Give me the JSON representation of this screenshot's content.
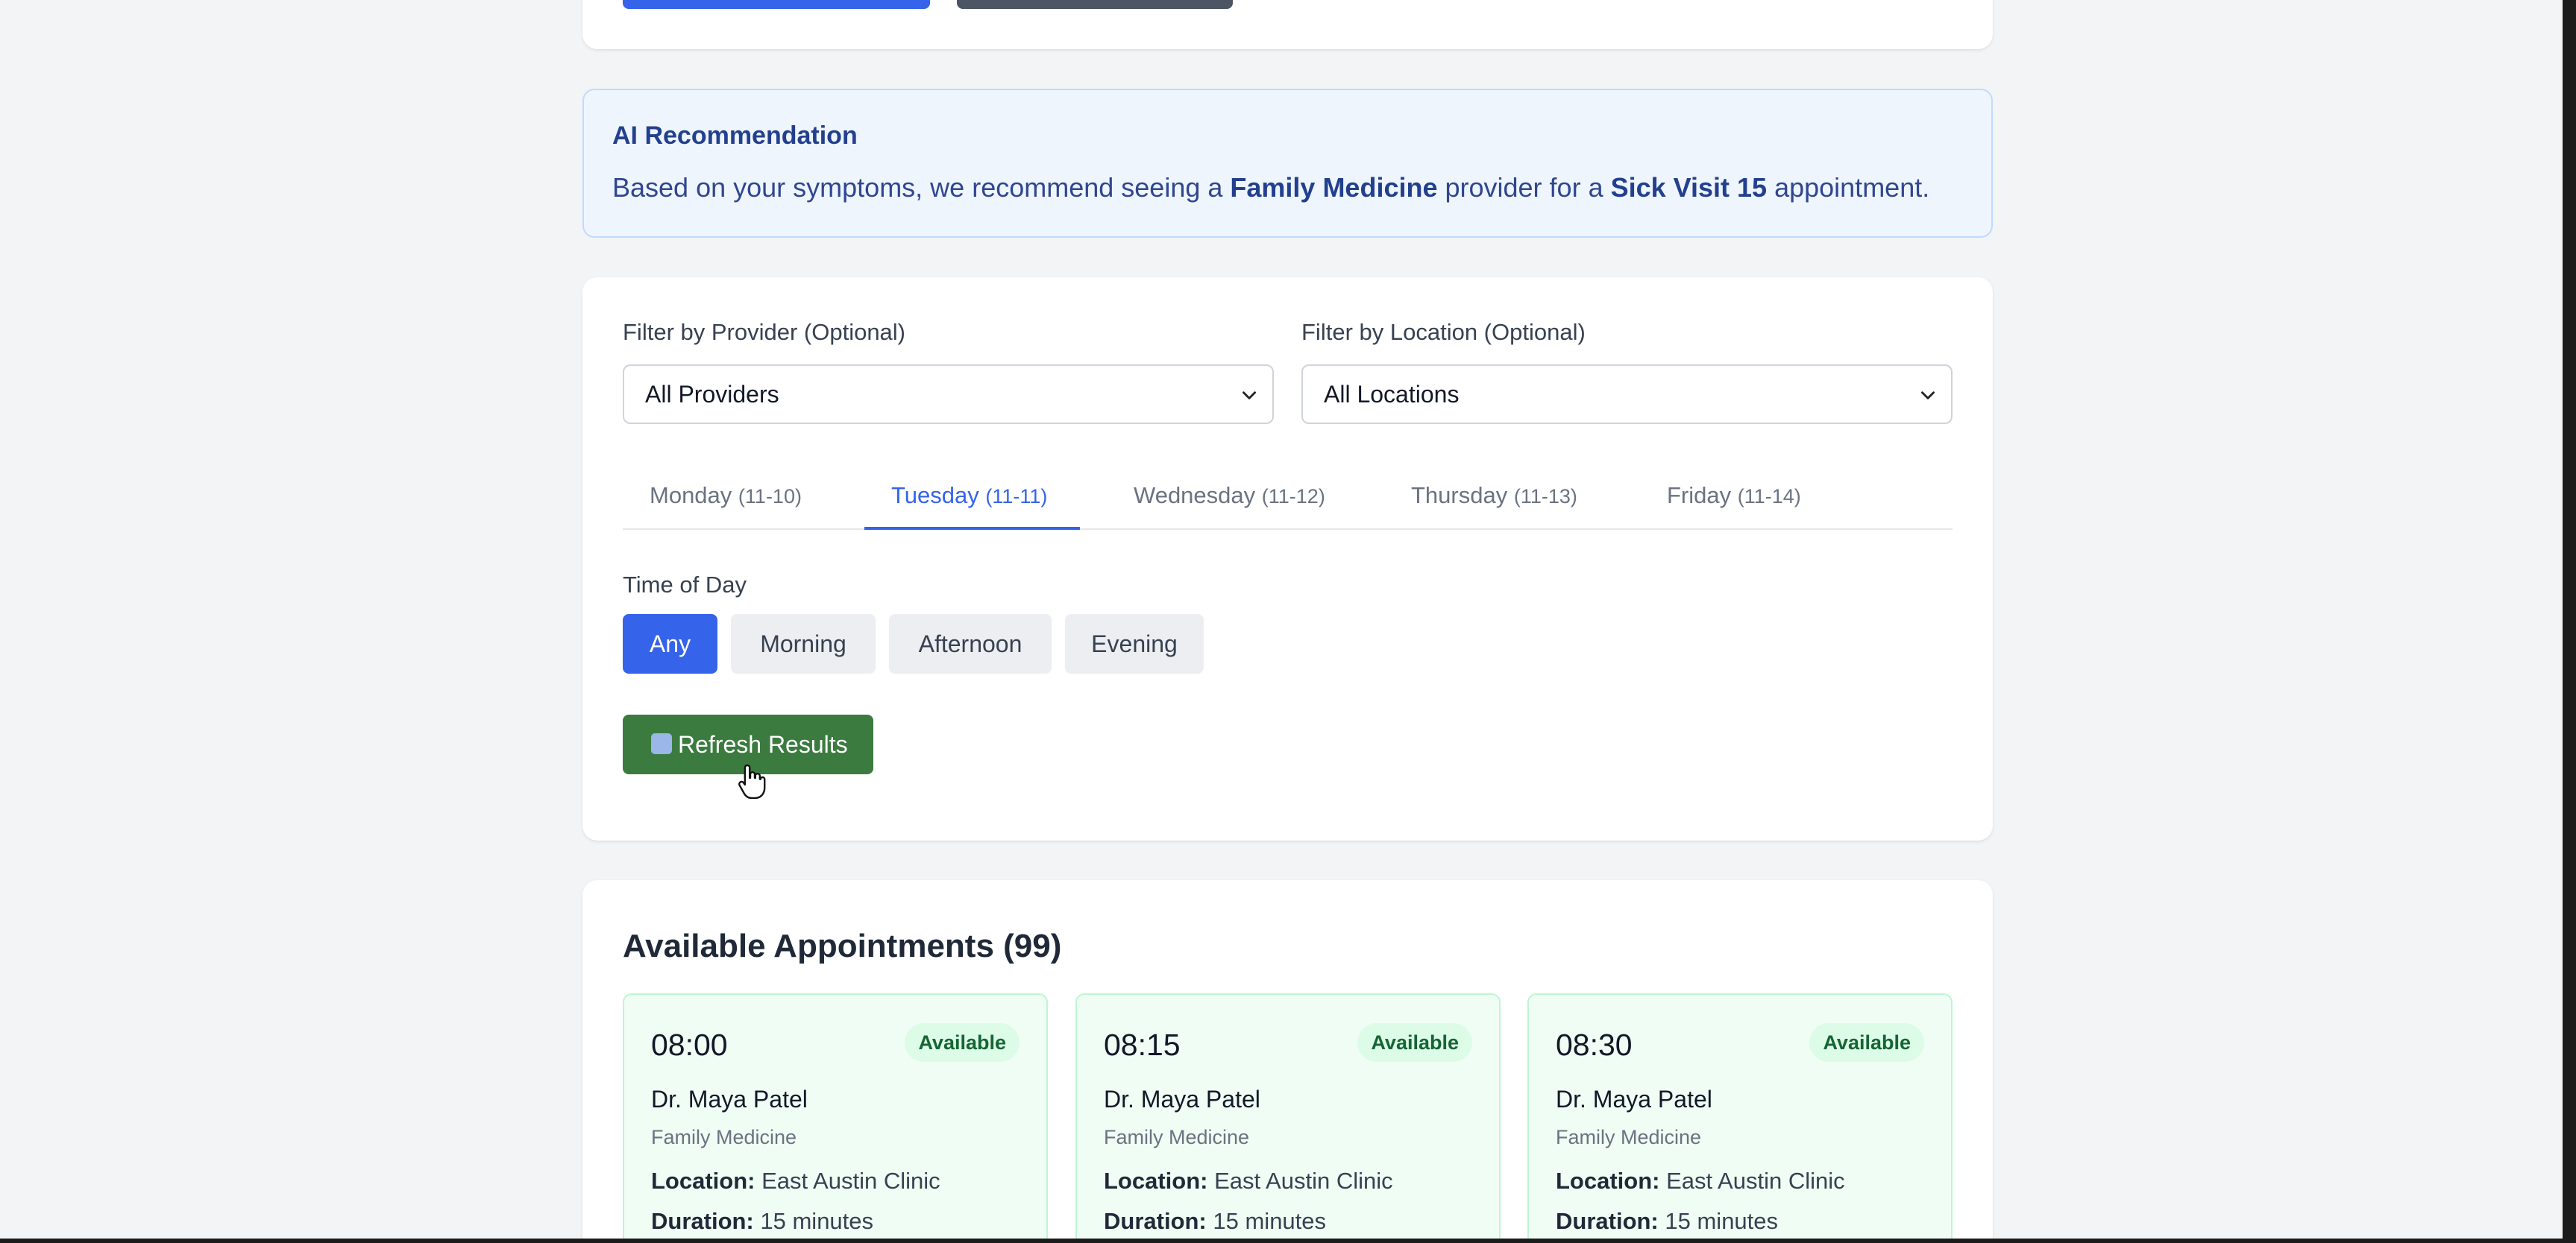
{
  "top_card": {},
  "ai_recommendation": {
    "title": "AI Recommendation",
    "text_prefix": "Based on your symptoms, we recommend seeing a ",
    "specialty": "Family Medicine",
    "text_middle": " provider for a ",
    "visit_type": "Sick Visit 15",
    "text_suffix": " appointment."
  },
  "filters": {
    "provider_label": "Filter by Provider (Optional)",
    "provider_value": "All Providers",
    "location_label": "Filter by Location (Optional)",
    "location_value": "All Locations"
  },
  "days": [
    {
      "name": "Monday",
      "date": "(11-10)"
    },
    {
      "name": "Tuesday",
      "date": "(11-11)"
    },
    {
      "name": "Wednesday",
      "date": "(11-12)"
    },
    {
      "name": "Thursday",
      "date": "(11-13)"
    },
    {
      "name": "Friday",
      "date": "(11-14)"
    }
  ],
  "active_day": "Tuesday",
  "time_of_day": {
    "label": "Time of Day",
    "options": [
      "Any",
      "Morning",
      "Afternoon",
      "Evening"
    ],
    "selected": "Any"
  },
  "refresh_label": "Refresh Results",
  "appointments": {
    "title": "Available Appointments (99)",
    "slots": [
      {
        "time": "08:00",
        "status": "Available",
        "provider": "Dr. Maya Patel",
        "specialty": "Family Medicine",
        "location_label": "Location:",
        "location": "East Austin Clinic",
        "duration_label": "Duration:",
        "duration": "15 minutes"
      },
      {
        "time": "08:15",
        "status": "Available",
        "provider": "Dr. Maya Patel",
        "specialty": "Family Medicine",
        "location_label": "Location:",
        "location": "East Austin Clinic",
        "duration_label": "Duration:",
        "duration": "15 minutes"
      },
      {
        "time": "08:30",
        "status": "Available",
        "provider": "Dr. Maya Patel",
        "specialty": "Family Medicine",
        "location_label": "Location:",
        "location": "East Austin Clinic",
        "duration_label": "Duration:",
        "duration": "15 minutes"
      }
    ]
  },
  "colors": {
    "primary": "#3563e9",
    "success": "#3b7b3f",
    "available_bg": "#f0fdf4"
  }
}
